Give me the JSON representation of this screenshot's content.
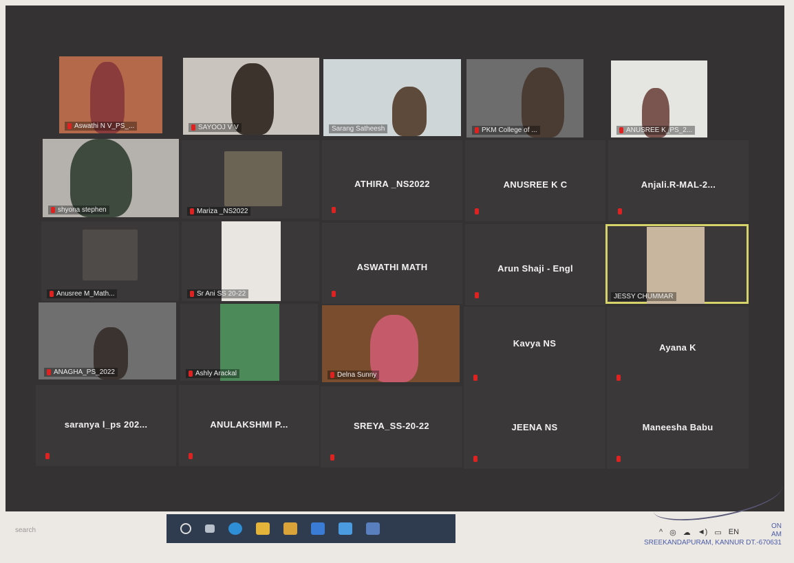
{
  "tiles": {
    "t1": "Aswathi N V_PS_...",
    "t2": "SAYOOJ V V",
    "t3": "Sarang Satheesh",
    "t4": "PKM College of ...",
    "t5": "ANUSREE K_PS_2...",
    "t6": "shyona stephen",
    "t7": "Mariza _NS2022",
    "t8": "ATHIRA _NS2022",
    "t9": "ANUSREE K C",
    "t10": "Anjali.R-MAL-2...",
    "t11": "Anusree M_Math...",
    "t12": "Sr Ani SS 20-22",
    "t13": "ASWATHI MATH",
    "t14": "Arun Shaji - Engl",
    "t15": "JESSY CHUMMAR",
    "t16": "ANAGHA_PS_2022",
    "t17": "Ashly Arackal",
    "t18": "Delna Sunny",
    "t19": "Kavya NS",
    "t20": "Ayana K",
    "t21": "saranya l_ps 202...",
    "t22": "ANULAKSHMI P...",
    "t23": "SREYA_SS-20-22",
    "t24": "JEENA NS",
    "t25": "Maneesha Babu"
  },
  "search_text": "search",
  "stamp": {
    "line1": "ON",
    "line2": "AM",
    "line3": "SREEKANDAPURAM, KANNUR DT.-670631"
  },
  "tray_lang": "EN",
  "colors": {
    "active_border": "#d6d36a",
    "muted_mic": "#d22"
  }
}
